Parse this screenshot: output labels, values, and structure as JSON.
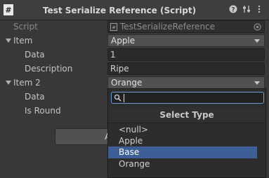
{
  "component": {
    "title": "Test Serialize Reference (Script)",
    "icons": [
      "script-hash-icon",
      "help-icon",
      "preset-icon",
      "menu-icon"
    ]
  },
  "script_row": {
    "label": "Script",
    "value": "TestSerializeReference"
  },
  "item": {
    "label": "Item",
    "type_value": "Apple",
    "data_label": "Data",
    "data_value": "1",
    "description_label": "Description",
    "description_value": "Ripe"
  },
  "item2": {
    "label": "Item 2",
    "type_value": "Orange",
    "data_label": "Data",
    "is_round_label": "Is Round"
  },
  "add_button": {
    "label": "A"
  },
  "type_dropdown": {
    "title": "Select Type",
    "search_value": "",
    "options": [
      "<null>",
      "Apple",
      "Base",
      "Orange"
    ],
    "selected": "Base"
  },
  "colors": {
    "background": "#383838",
    "selection": "#3e5f96",
    "search_border": "#6d9bd6"
  }
}
